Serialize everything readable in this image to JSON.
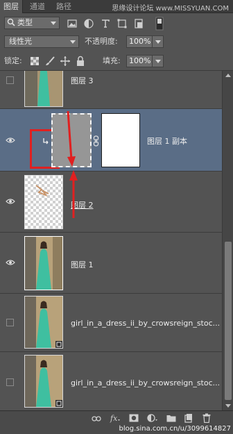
{
  "tabs": [
    {
      "label": "图层"
    },
    {
      "label": "通道"
    },
    {
      "label": "路径"
    }
  ],
  "watermark": "思缘设计论坛 www.MISSYUAN.COM",
  "filter": {
    "kind_label": "类型"
  },
  "blend": {
    "mode": "线性光",
    "opacity_label": "不透明度:",
    "opacity_value": "100%"
  },
  "lock": {
    "label": "锁定:",
    "fill_label": "填充:",
    "fill_value": "100%"
  },
  "layers": [
    {
      "name": "图层 3",
      "visible": false,
      "selected": false
    },
    {
      "name": "图层 1 副本",
      "visible": true,
      "selected": true
    },
    {
      "name": "图层 2",
      "visible": true,
      "selected": false
    },
    {
      "name": "图层 1",
      "visible": true,
      "selected": false
    },
    {
      "name": "girl_in_a_dress_ii_by_crowsreign_stoc...",
      "visible": false,
      "selected": false
    },
    {
      "name": "girl_in_a_dress_ii_by_crowsreign_stoc...",
      "visible": false,
      "selected": false
    }
  ],
  "credit": "blog.sina.com.cn/u/3099614827",
  "colors": {
    "panel": "#535353",
    "selected": "#5a6d86",
    "highlight": "#e02020",
    "dress": "#3fbfa0"
  }
}
